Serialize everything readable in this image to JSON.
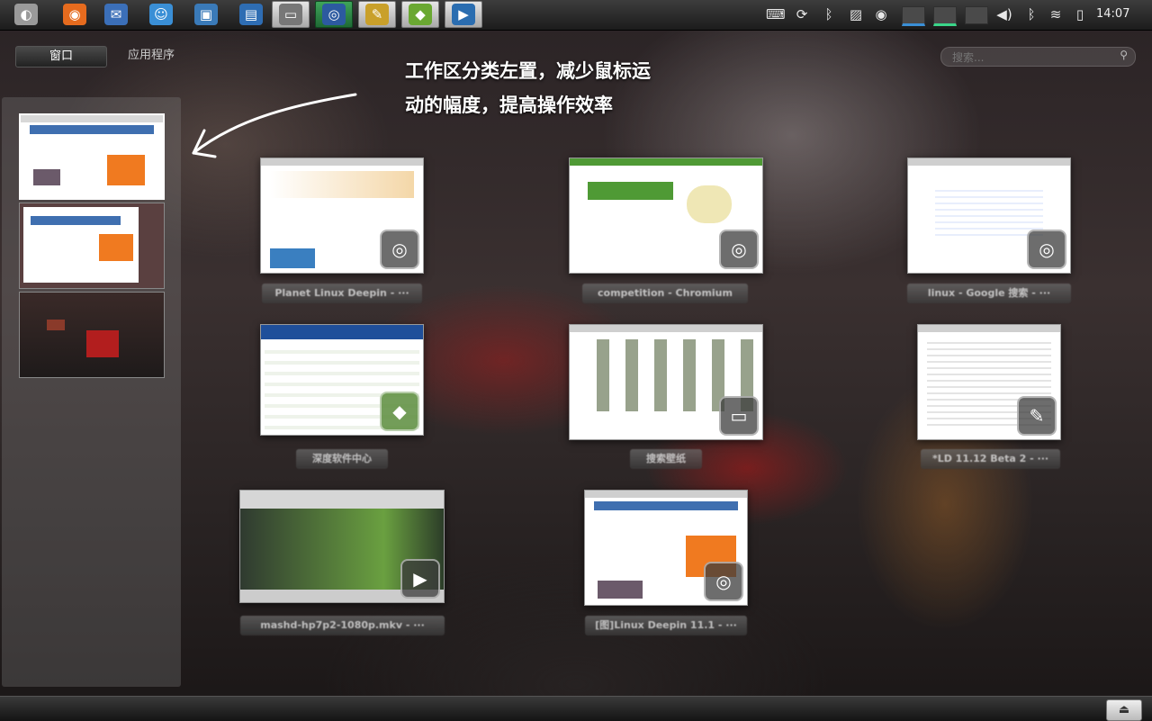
{
  "top_panel": {
    "launchers": [
      {
        "icon": "deepin-logo-icon",
        "glyph": "◐",
        "color": "#9a9a9a",
        "state": "normal"
      },
      {
        "icon": "firefox-icon",
        "glyph": "◉",
        "color": "#e66b1e",
        "state": "normal"
      },
      {
        "icon": "thunderbird-icon",
        "glyph": "✉",
        "color": "#3b6fb8",
        "state": "normal"
      },
      {
        "icon": "chat-icon",
        "glyph": "☺",
        "color": "#3a8fd6",
        "state": "normal"
      },
      {
        "icon": "image-viewer-icon",
        "glyph": "▣",
        "color": "#3a7ab8",
        "state": "normal"
      },
      {
        "icon": "document-icon",
        "glyph": "▤",
        "color": "#2e6db3",
        "state": "normal"
      },
      {
        "icon": "file-manager-icon",
        "glyph": "▭",
        "color": "#777777",
        "state": "running"
      },
      {
        "icon": "browser-icon",
        "glyph": "◎",
        "color": "#2c5aa0",
        "state": "active"
      },
      {
        "icon": "text-editor-icon",
        "glyph": "✎",
        "color": "#c9a02a",
        "state": "running"
      },
      {
        "icon": "software-center-icon",
        "glyph": "◆",
        "color": "#6aa832",
        "state": "running"
      },
      {
        "icon": "video-player-icon",
        "glyph": "▶",
        "color": "#2a6db0",
        "state": "running"
      }
    ],
    "tray": [
      "keyboard-icon",
      "sync-icon",
      "bluetooth-icon",
      "display-icon",
      "disc-icon"
    ],
    "tray_right": [
      "volume-icon",
      "bluetooth-icon",
      "wifi-icon",
      "battery-icon"
    ],
    "clock": "14:07"
  },
  "modes": {
    "windows_label": "窗口",
    "apps_label": "应用程序"
  },
  "search": {
    "placeholder": "搜索..."
  },
  "caption": {
    "line1": "工作区分类左置，减少鼠标运",
    "line2": "动的幅度，提高操作效率"
  },
  "windows": [
    {
      "title": "Planet Linux Deepin - ···",
      "app_icon": "browser-icon"
    },
    {
      "title": "competition - Chromium",
      "app_icon": "browser-icon"
    },
    {
      "title": "linux - Google 搜索 - ···",
      "app_icon": "browser-icon"
    },
    {
      "title": "深度软件中心",
      "app_icon": "software-center-icon"
    },
    {
      "title": "搜索壁纸",
      "app_icon": "file-manager-icon"
    },
    {
      "title": "*LD 11.12 Beta 2 - ···",
      "app_icon": "text-editor-icon"
    },
    {
      "title": "mashd-hp7p2-1080p.mkv - ···",
      "app_icon": "video-player-icon"
    },
    {
      "title": "[图]Linux Deepin 11.1 - ···",
      "app_icon": "browser-icon"
    }
  ]
}
